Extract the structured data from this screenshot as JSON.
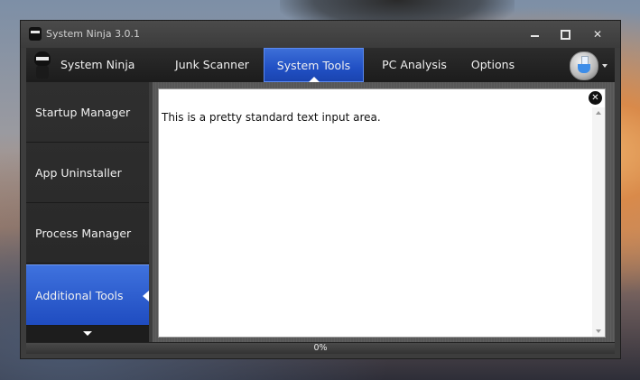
{
  "window": {
    "title": "System Ninja 3.0.1",
    "controls": {
      "minimize": "",
      "maximize": "",
      "close": "✕"
    }
  },
  "navbar": {
    "brand": "System Ninja",
    "tabs": [
      {
        "label": "Junk Scanner",
        "active": false
      },
      {
        "label": "System Tools",
        "active": true
      },
      {
        "label": "PC Analysis",
        "active": false
      },
      {
        "label": "Options",
        "active": false
      }
    ],
    "accent_color": "#2150c4"
  },
  "sidebar": {
    "items": [
      {
        "label": "Startup Manager",
        "active": false
      },
      {
        "label": "App Uninstaller",
        "active": false
      },
      {
        "label": "Process Manager",
        "active": false
      },
      {
        "label": "Additional Tools",
        "active": true
      }
    ]
  },
  "content": {
    "text": "This is a pretty standard text input area.",
    "close_glyph": "✕"
  },
  "progress": {
    "label": "0%",
    "value": 0
  },
  "icons": {
    "app": "ninja-icon",
    "brand": "ninja-logo-icon",
    "options_menu": "flask-icon"
  }
}
